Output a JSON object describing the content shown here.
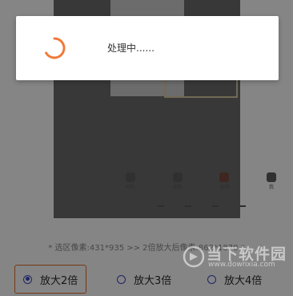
{
  "dialog": {
    "message": "处理中......"
  },
  "preview": {
    "apps": [
      {
        "label": "相机",
        "icon": "app-icon"
      },
      {
        "label": "视频",
        "icon": "app-icon"
      },
      {
        "label": "电视",
        "icon": "app-icon"
      },
      {
        "label": "我",
        "icon": "app-icon"
      }
    ]
  },
  "info": {
    "text": "* 选区像素:431*935 >> 2倍放大后像素:862*1870 *"
  },
  "scale_options": [
    {
      "label": "放大2倍",
      "selected": true
    },
    {
      "label": "放大3倍",
      "selected": false
    },
    {
      "label": "放大4倍",
      "selected": false
    }
  ],
  "watermark": {
    "text": "当下软件园",
    "sub": "www.downxia.com"
  },
  "colors": {
    "accent": "#e06b2a",
    "radio": "#3a47c0",
    "spinner": "#f07a3a"
  }
}
